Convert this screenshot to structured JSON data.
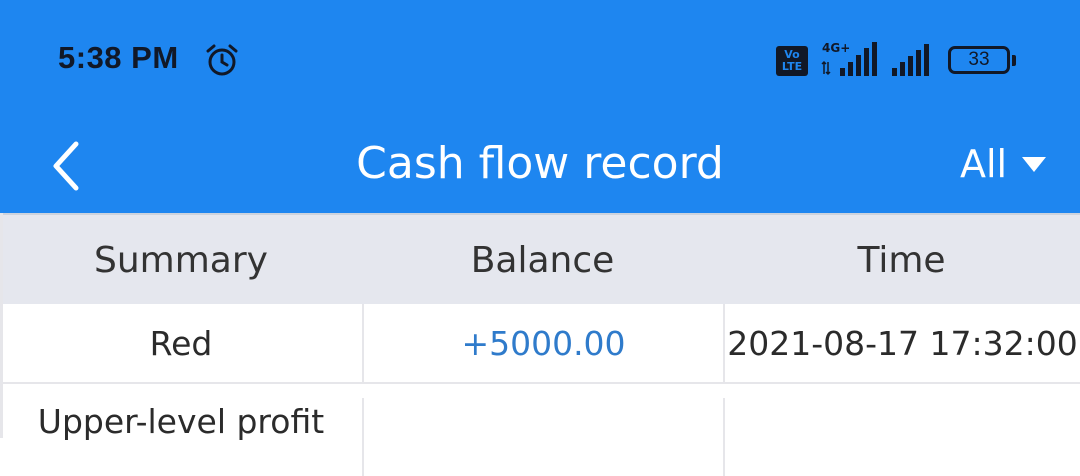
{
  "status_bar": {
    "time": "5:38 PM",
    "volte_label": "Vo LTE",
    "network_label": "4G+",
    "battery": "33"
  },
  "nav": {
    "title": "Cash flow record",
    "filter_label": "All"
  },
  "table": {
    "columns": [
      "Summary",
      "Balance",
      "Time"
    ],
    "rows": [
      {
        "summary": "Red",
        "balance": "+5000.00",
        "time": "2021-08-17 17:32:00"
      },
      {
        "summary": "Upper-level profit",
        "balance": "",
        "time": ""
      }
    ]
  },
  "colors": {
    "header_bg": "#1e86f0",
    "table_header_bg": "#e5e7ee",
    "amount_positive": "#2f7bcb"
  }
}
